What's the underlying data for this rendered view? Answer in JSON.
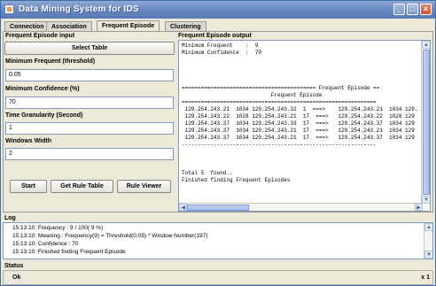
{
  "window": {
    "title": "Data Mining System for IDS",
    "minimize": "_",
    "maximize": "□",
    "close": "×"
  },
  "tabs": [
    {
      "label": "Connection",
      "active": false
    },
    {
      "label": "Association",
      "active": false
    },
    {
      "label": "Frequent Episode",
      "active": true
    },
    {
      "label": "Clustering",
      "active": false
    }
  ],
  "input_panel": {
    "title": "Frequent Episode input",
    "select_table_label": "Select Table",
    "min_frequent_label": "Minimum Frequent (threshold)",
    "min_frequent_value": "0.05",
    "min_confidence_label": "Minimum Confidence (%)",
    "min_confidence_value": "70",
    "time_granularity_label": "Time Granularity (Second)",
    "time_granularity_value": "1",
    "window_width_label": "Windows Width",
    "window_width_value": "2",
    "start_label": "Start",
    "get_rule_table_label": "Get Rule Table",
    "rule_viewer_label": "Rule Viewer"
  },
  "output_panel": {
    "title": "Frequent Episode output",
    "text": "Minimum Frequent    :  9\nMinimum Confidence  :  70\n\n\n\n\n========================================== Frequent Episode ==\n                            Frequent Episode\n=============================================================\n 129.254.243.21  1034 129.254.243.32  1  ===>    129.254.243.21  1034 129.\n 129.254.243.22  1028 129.254.243.21  17  ===>   129.254.243.22  1028 129\n 129.254.243.37  1034 129.254.243.33  17  ===>   129.254.243.37  1034 129\n 129.254.243.37  1034 129.254.243.21  17  ===>   129.254.243.21  1034 129\n 129.254.243.37  1034 129.254.243.21  17  ===>   129.254.243.37  1034 129\n-------------------------------------------------------------\n\n\n\nTotal 5  found..\nFinished finding Frequent Episodes"
  },
  "log": {
    "title": "Log",
    "lines": [
      "15:13:10: Frequency : 9 / 100( 9 %)",
      "15:13:10: Meaning   : Frequency(9) = Threshold(0.05) * Window Number(197)",
      "15:13:10: Confidence : 70",
      "15:13:10: Finished finding Frequent Episode"
    ]
  },
  "status": {
    "title": "Status",
    "text": "Ok",
    "close_mark": "x 1"
  }
}
